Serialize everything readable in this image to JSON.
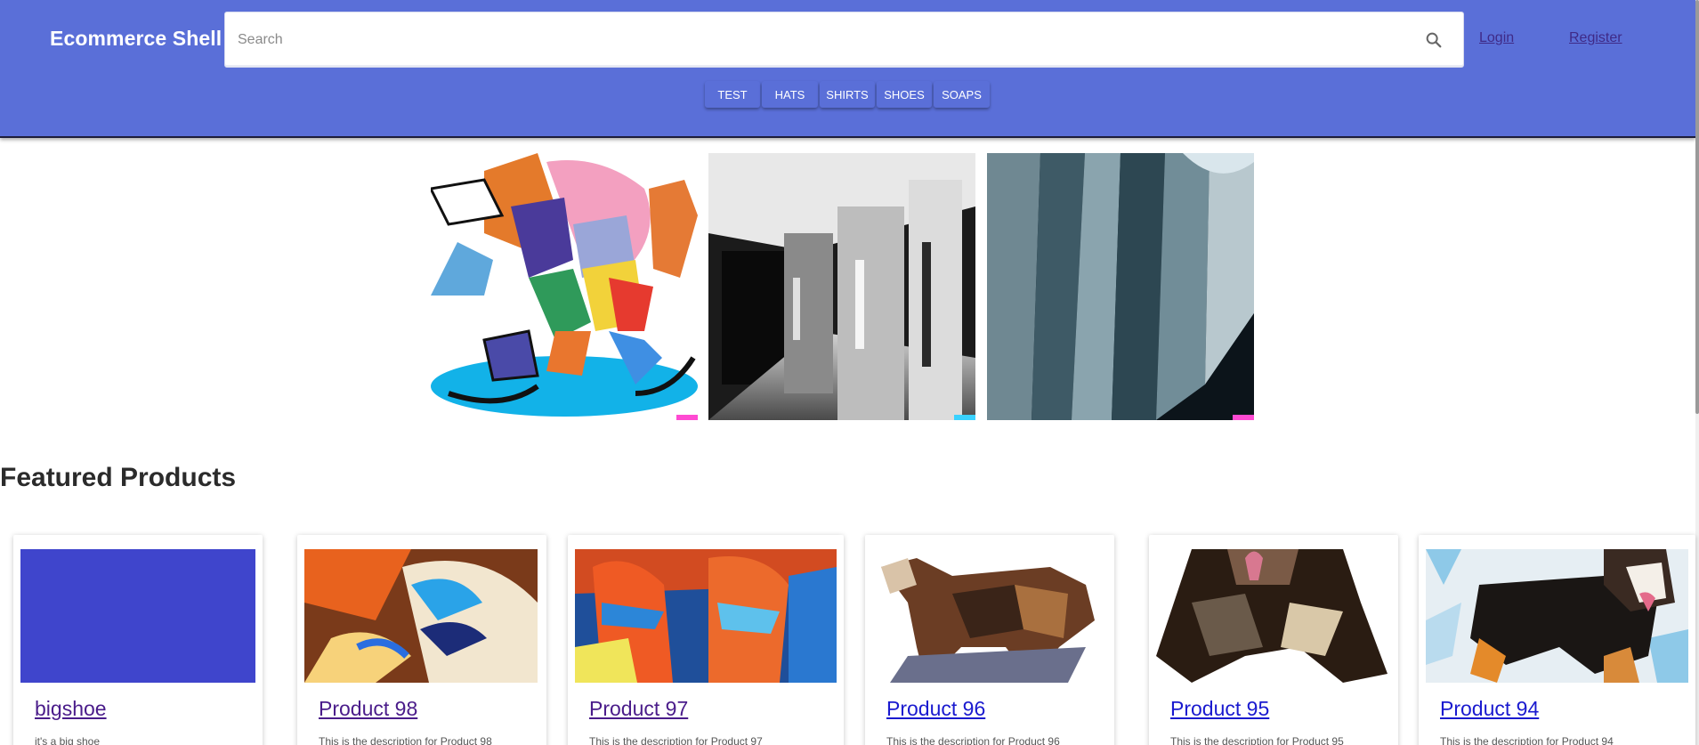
{
  "header": {
    "brand": "Ecommerce Shell",
    "search_placeholder": "Search",
    "search_value": "",
    "login": "Login",
    "register": "Register",
    "background_color": "#5a6fd8"
  },
  "categories": [
    "TEST",
    "HATS",
    "SHIRTS",
    "SHOES",
    "SOAPS"
  ],
  "hero_images": [
    {
      "name": "corgi-ice-skating-image"
    },
    {
      "name": "hallway-doors-image"
    },
    {
      "name": "curtain-folds-image"
    }
  ],
  "featured": {
    "title": "Featured Products",
    "products": [
      {
        "title": "bigshoe",
        "description": "it's a big shoe",
        "visited": true
      },
      {
        "title": "Product 98",
        "description": "This is the description for Product 98",
        "visited": true
      },
      {
        "title": "Product 97",
        "description": "This is the description for Product 97",
        "visited": true
      },
      {
        "title": "Product 96",
        "description": "This is the description for Product 96",
        "visited": false
      },
      {
        "title": "Product 95",
        "description": "This is the description for Product 95",
        "visited": false
      },
      {
        "title": "Product 94",
        "description": "This is the description for Product 94",
        "visited": false
      }
    ]
  },
  "colors": {
    "link_visited": "#4a1c8a",
    "link_unvisited": "#1a1acf",
    "placeholder_block": "#3f45cc"
  }
}
